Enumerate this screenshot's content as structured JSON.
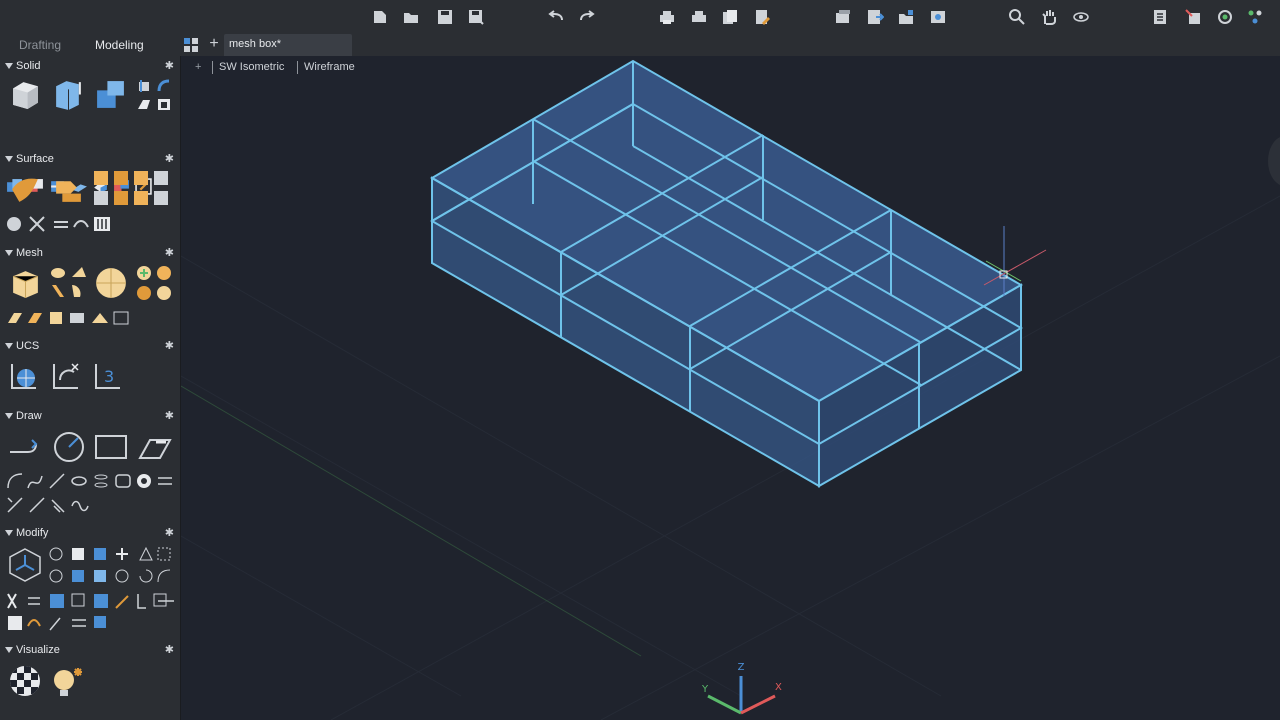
{
  "workspace_tabs": [
    "Drafting",
    "Modeling"
  ],
  "document": {
    "tab_title": "mesh box*"
  },
  "viewport": {
    "controls": "+",
    "view": "SW Isometric",
    "visual_style": "Wireframe"
  },
  "toolbar_icons": [
    "new-icon",
    "open-icon",
    "save-icon",
    "save-as-icon",
    "undo-icon",
    "redo-icon",
    "print-icon",
    "plot-icon",
    "publish-icon",
    "properties-icon",
    "layer-icon",
    "block-icon",
    "insert-icon",
    "render-icon",
    "zoom-icon",
    "pan-icon",
    "orbit-icon",
    "layout-icon",
    "share-icon",
    "sync-icon",
    "settings-icon"
  ],
  "palette": {
    "sections": [
      {
        "title": "Solid"
      },
      {
        "title": "Surface"
      },
      {
        "title": "Mesh"
      },
      {
        "title": "UCS"
      },
      {
        "title": "Draw"
      },
      {
        "title": "Modify"
      },
      {
        "title": "Visualize"
      }
    ],
    "ucs_button_text": "3"
  },
  "colors": {
    "accent": "#4b8fd6",
    "mesh_fill": "#3a5a8f",
    "mesh_edge": "#6fc3ea",
    "viewport_bg": "#1f232d",
    "panel_bg": "#2b2e33"
  }
}
